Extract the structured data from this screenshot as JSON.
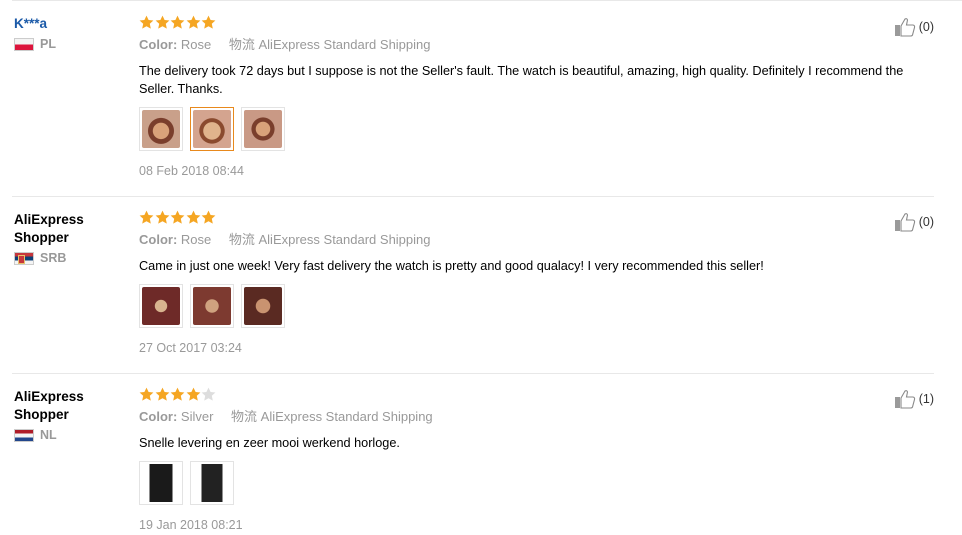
{
  "reviews": [
    {
      "user": "K***a",
      "country": "PL",
      "rating": 5,
      "color_label": "Color:",
      "color_value": "Rose",
      "shipping": "物流 AliExpress Standard Shipping",
      "text": "The delivery took 72 days but I suppose is not the Seller's fault. The watch is beautiful, amazing, high quality. Definitely I recommend the Seller. Thanks.",
      "likes": "(0)",
      "date": "08 Feb 2018 08:44"
    },
    {
      "user": "AliExpress Shopper",
      "country": "SRB",
      "rating": 5,
      "color_label": "Color:",
      "color_value": "Rose",
      "shipping": "物流 AliExpress Standard Shipping",
      "text": "Came in just one week! Very fast delivery the watch is pretty and good qualacy! I very recommended this seller!",
      "likes": "(0)",
      "date": "27 Oct 2017 03:24"
    },
    {
      "user": "AliExpress Shopper",
      "country": "NL",
      "rating": 4,
      "color_label": "Color:",
      "color_value": "Silver",
      "shipping": "物流 AliExpress Standard Shipping",
      "text": "Snelle levering en zeer mooi werkend horloge.",
      "likes": "(1)",
      "date": "19 Jan 2018 08:21"
    }
  ],
  "colors": {
    "star_on": "#f5a623",
    "star_off": "#dddddd",
    "username_link": "#1b5aa8",
    "meta_gray": "#999999",
    "thumb_selected": "#e8891d"
  },
  "icons": [
    "thumbs-up-icon",
    "star-icon",
    "flag-icon"
  ]
}
